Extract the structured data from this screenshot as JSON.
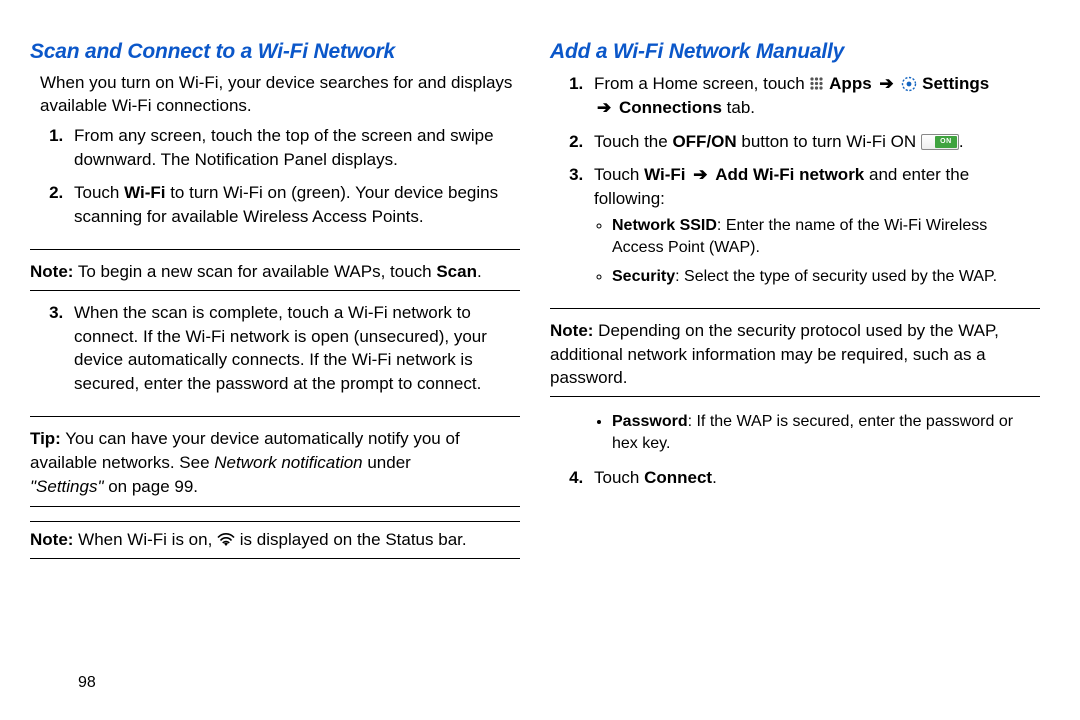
{
  "left": {
    "heading": "Scan and Connect to a Wi-Fi Network",
    "intro": "When you turn on Wi-Fi, your device searches for and displays available Wi-Fi connections.",
    "step1": "From any screen, touch the top of the screen and swipe downward. The Notification Panel displays.",
    "step2_pre": "Touch ",
    "step2_b": "Wi-Fi",
    "step2_post": " to turn Wi-Fi on (green). Your device begins scanning for available Wireless Access Points.",
    "note1_label": "Note:",
    "note1_body_pre": " To begin a new scan for available WAPs, touch ",
    "note1_b": "Scan",
    "note1_post": ".",
    "step3": "When the scan is complete, touch a Wi-Fi network to connect. If the Wi-Fi network is open (unsecured), your device automatically connects. If the Wi-Fi network is secured, enter the password at the prompt to connect.",
    "tip_label": "Tip:",
    "tip_body_pre": " You can have your device automatically notify you of available networks. See ",
    "tip_i1": "Network notification",
    "tip_mid": " under ",
    "tip_i2": "\"Settings\"",
    "tip_post": " on page 99.",
    "note2_label": "Note:",
    "note2_pre": " When Wi-Fi is on, ",
    "note2_post": " is displayed on the Status bar."
  },
  "right": {
    "heading": "Add a Wi-Fi Network Manually",
    "step1_pre": "From a Home screen, touch ",
    "step1_apps": "Apps",
    "step1_settings": "Settings",
    "step1_conn": "Connections",
    "step1_tab": " tab.",
    "arrow": "➔",
    "step2_pre": "Touch the ",
    "step2_b": "OFF/ON",
    "step2_mid": " button to turn Wi-Fi ON ",
    "step2_post": ".",
    "toggle_text": "ON",
    "step3_pre": "Touch ",
    "step3_b1": "Wi-Fi",
    "step3_b2": "Add Wi-Fi network",
    "step3_post": " and enter the following:",
    "bullet1_b": "Network SSID",
    "bullet1_body": ": Enter the name of the Wi-Fi Wireless Access Point (WAP).",
    "bullet2_b": "Security",
    "bullet2_body": ": Select the type of security used by the WAP.",
    "note_label": "Note:",
    "note_body": " Depending on the security protocol used by the WAP, additional network information may be required, such as a password.",
    "bullet3_b": "Password",
    "bullet3_body": ": If the WAP is secured, enter the password or hex key.",
    "step4_pre": "Touch ",
    "step4_b": "Connect",
    "step4_post": "."
  },
  "page_number": "98"
}
